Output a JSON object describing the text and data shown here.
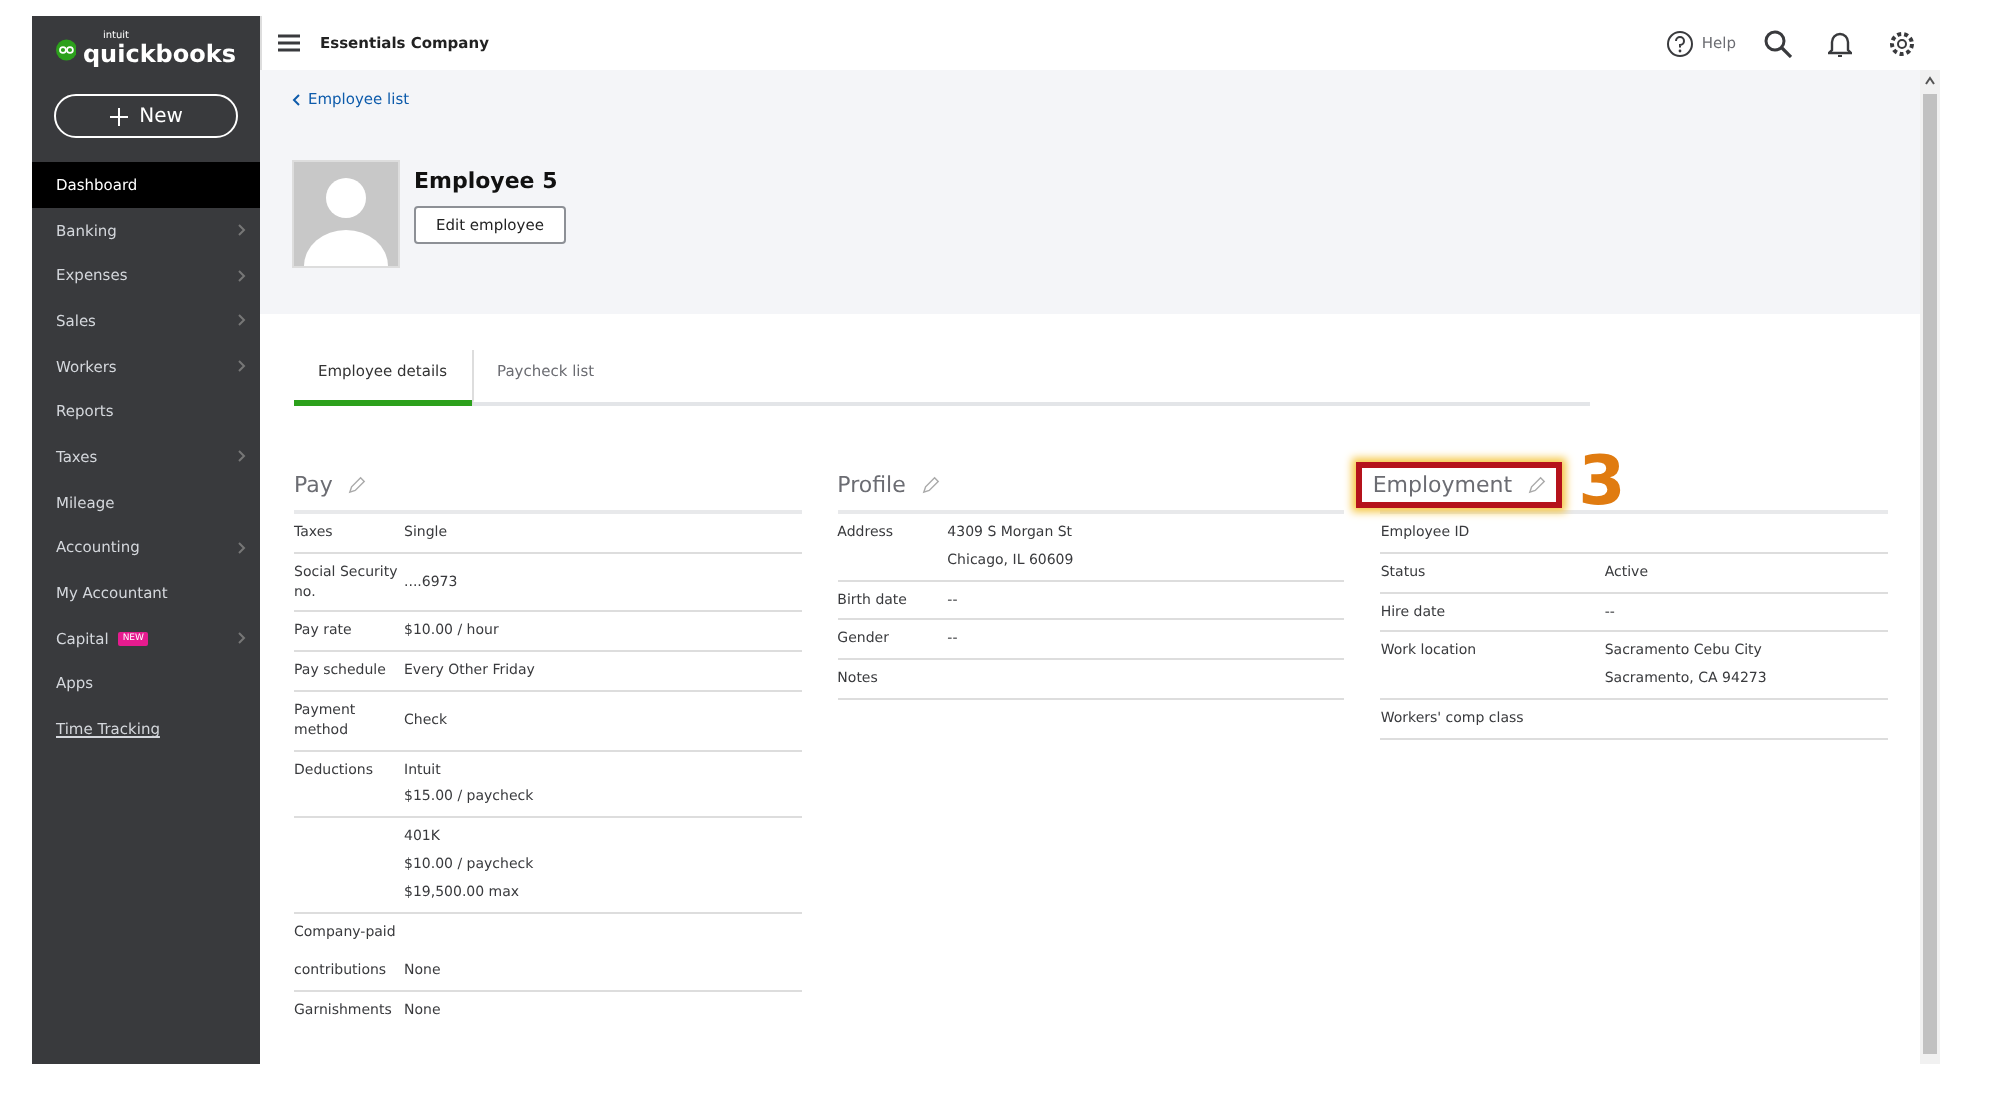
{
  "sidebar": {
    "brand_small": "intuit",
    "brand": "quickbooks",
    "new_button": "New",
    "items": [
      {
        "label": "Dashboard",
        "selected": true,
        "expandable": false,
        "kind": "item"
      },
      {
        "label": "Banking",
        "selected": false,
        "expandable": true,
        "kind": "item"
      },
      {
        "label": "Expenses",
        "selected": false,
        "expandable": true,
        "kind": "item"
      },
      {
        "label": "Sales",
        "selected": false,
        "expandable": true,
        "kind": "item"
      },
      {
        "label": "Workers",
        "selected": false,
        "expandable": true,
        "kind": "item"
      },
      {
        "label": "Reports",
        "selected": false,
        "expandable": false,
        "kind": "item"
      },
      {
        "label": "Taxes",
        "selected": false,
        "expandable": true,
        "kind": "item"
      },
      {
        "label": "Mileage",
        "selected": false,
        "expandable": false,
        "kind": "item"
      },
      {
        "label": "Accounting",
        "selected": false,
        "expandable": true,
        "kind": "item"
      },
      {
        "label": "My Accountant",
        "selected": false,
        "expandable": false,
        "kind": "item"
      },
      {
        "label": "Capital",
        "badge": "NEW",
        "selected": false,
        "expandable": true,
        "kind": "item"
      },
      {
        "label": "Apps",
        "selected": false,
        "expandable": false,
        "kind": "item"
      },
      {
        "label": "Time Tracking",
        "selected": false,
        "expandable": false,
        "kind": "link"
      }
    ]
  },
  "topbar": {
    "company": "Essentials Company",
    "help": "Help"
  },
  "back_link": "Employee list",
  "employee": {
    "name": "Employee 5",
    "edit_button": "Edit employee"
  },
  "tabs": [
    {
      "label": "Employee details",
      "selected": true
    },
    {
      "label": "Paycheck list",
      "selected": false
    }
  ],
  "sections": [
    {
      "title": "Pay",
      "highlighted": false,
      "rows": [
        {
          "label": "Taxes",
          "values": [
            "Single"
          ],
          "ruled": true
        },
        {
          "label": "Social Security no.",
          "values": [
            "....6973"
          ],
          "ruled": true
        },
        {
          "label": "Pay rate",
          "values": [
            "$10.00 / hour"
          ],
          "ruled": true
        },
        {
          "label": "Pay schedule",
          "values": [
            "Every Other Friday"
          ],
          "ruled": true
        },
        {
          "label": "Payment method",
          "values": [
            "Check"
          ],
          "ruled": true
        },
        {
          "label": "Deductions",
          "values": [
            "Intuit",
            "$15.00 / paycheck"
          ],
          "ruled": true
        },
        {
          "values": [
            "401K",
            "$10.00 / paycheck",
            "$19,500.00 max"
          ],
          "ruled": true
        },
        {
          "label": "Company-paid",
          "values": [],
          "ruled": false
        },
        {
          "label": "contributions",
          "values": [
            "None"
          ],
          "ruled": true
        },
        {
          "label": "Garnishments",
          "values": [
            "None"
          ],
          "ruled": false
        }
      ]
    },
    {
      "title": "Profile",
      "highlighted": false,
      "rows": [
        {
          "label": "Address",
          "values": [
            "4309 S Morgan St",
            "Chicago, IL 60609"
          ],
          "ruled": true
        },
        {
          "label": "Birth date",
          "values": [
            "--"
          ],
          "ruled": true
        },
        {
          "label": "Gender",
          "values": [
            "--"
          ],
          "ruled": true
        },
        {
          "label": "Notes",
          "values": [],
          "ruled": true
        }
      ]
    },
    {
      "title": "Employment",
      "highlighted": true,
      "callout": "3",
      "rows": [
        {
          "label": "Employee ID",
          "values": [],
          "ruled": true
        },
        {
          "label": "Status",
          "values": [
            "Active"
          ],
          "ruled": true
        },
        {
          "label": "Hire date",
          "values": [
            "--"
          ],
          "ruled": true
        },
        {
          "label": "Work location",
          "values": [
            "Sacramento Cebu City",
            "Sacramento, CA 94273"
          ],
          "ruled": true
        },
        {
          "label": "Workers' comp class",
          "values": [],
          "ruled": true
        }
      ]
    }
  ]
}
